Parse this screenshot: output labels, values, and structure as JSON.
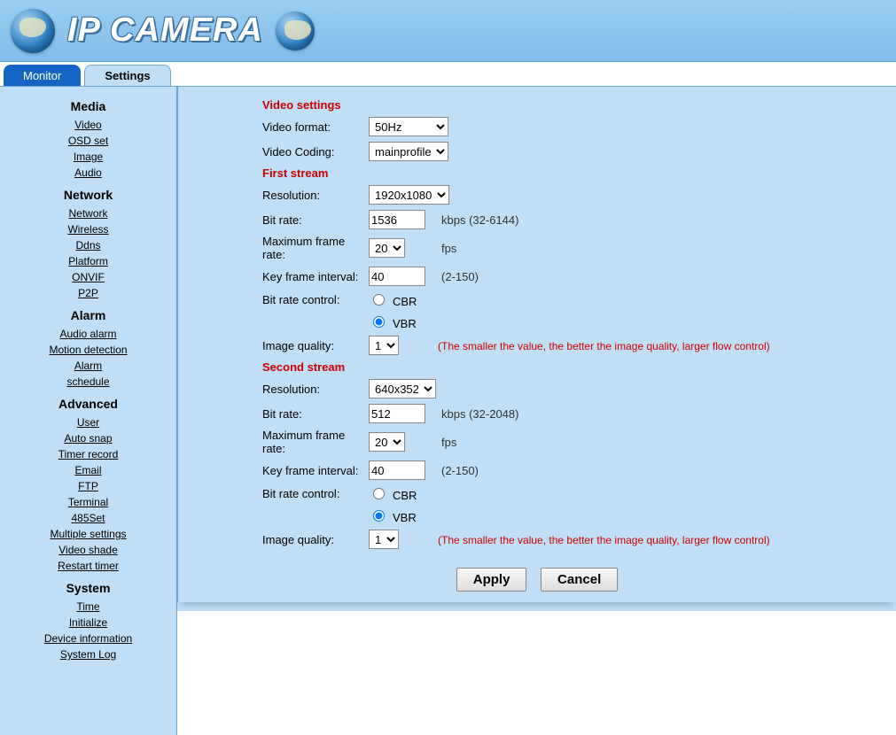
{
  "header": {
    "title": "IP CAMERA"
  },
  "tabs": {
    "monitor": "Monitor",
    "settings": "Settings"
  },
  "sidebar": {
    "groups": [
      {
        "title": "Media",
        "items": [
          "Video",
          "OSD set",
          "Image",
          "Audio"
        ]
      },
      {
        "title": "Network",
        "items": [
          "Network",
          "Wireless",
          "Ddns",
          "Platform",
          "ONVIF",
          "P2P"
        ]
      },
      {
        "title": "Alarm",
        "items": [
          "Audio alarm",
          "Motion detection",
          "Alarm",
          "schedule"
        ]
      },
      {
        "title": "Advanced",
        "items": [
          "User",
          "Auto snap",
          "Timer record",
          "Email",
          "FTP",
          "Terminal",
          "485Set",
          "Multiple settings",
          "Video shade",
          "Restart timer"
        ]
      },
      {
        "title": "System",
        "items": [
          "Time",
          "Initialize",
          "Device information",
          "System Log"
        ]
      }
    ]
  },
  "form": {
    "sections": {
      "video_settings": "Video settings",
      "first_stream": "First stream",
      "second_stream": "Second stream"
    },
    "labels": {
      "video_format": "Video format:",
      "video_coding": "Video Coding:",
      "resolution": "Resolution:",
      "bit_rate": "Bit rate:",
      "max_frame": "Maximum frame rate:",
      "key_frame": "Key frame interval:",
      "bit_rate_control": "Bit rate control:",
      "image_quality": "Image quality:",
      "cbr": "CBR",
      "vbr": "VBR",
      "fps": "fps",
      "kbps": "kbps"
    },
    "hints": {
      "bitrate1": "(32-6144)",
      "bitrate2": "(32-2048)",
      "keyframe": "(2-150)",
      "quality": "(The smaller the value, the better the image quality, larger flow control)"
    },
    "values": {
      "video_format": "50Hz",
      "video_coding": "mainprofile",
      "stream1": {
        "resolution": "1920x1080",
        "bit_rate": "1536",
        "max_frame": "20",
        "key_frame": "40",
        "bit_rate_control": "VBR",
        "image_quality": "1"
      },
      "stream2": {
        "resolution": "640x352",
        "bit_rate": "512",
        "max_frame": "20",
        "key_frame": "40",
        "bit_rate_control": "VBR",
        "image_quality": "1"
      }
    },
    "buttons": {
      "apply": "Apply",
      "cancel": "Cancel"
    }
  }
}
